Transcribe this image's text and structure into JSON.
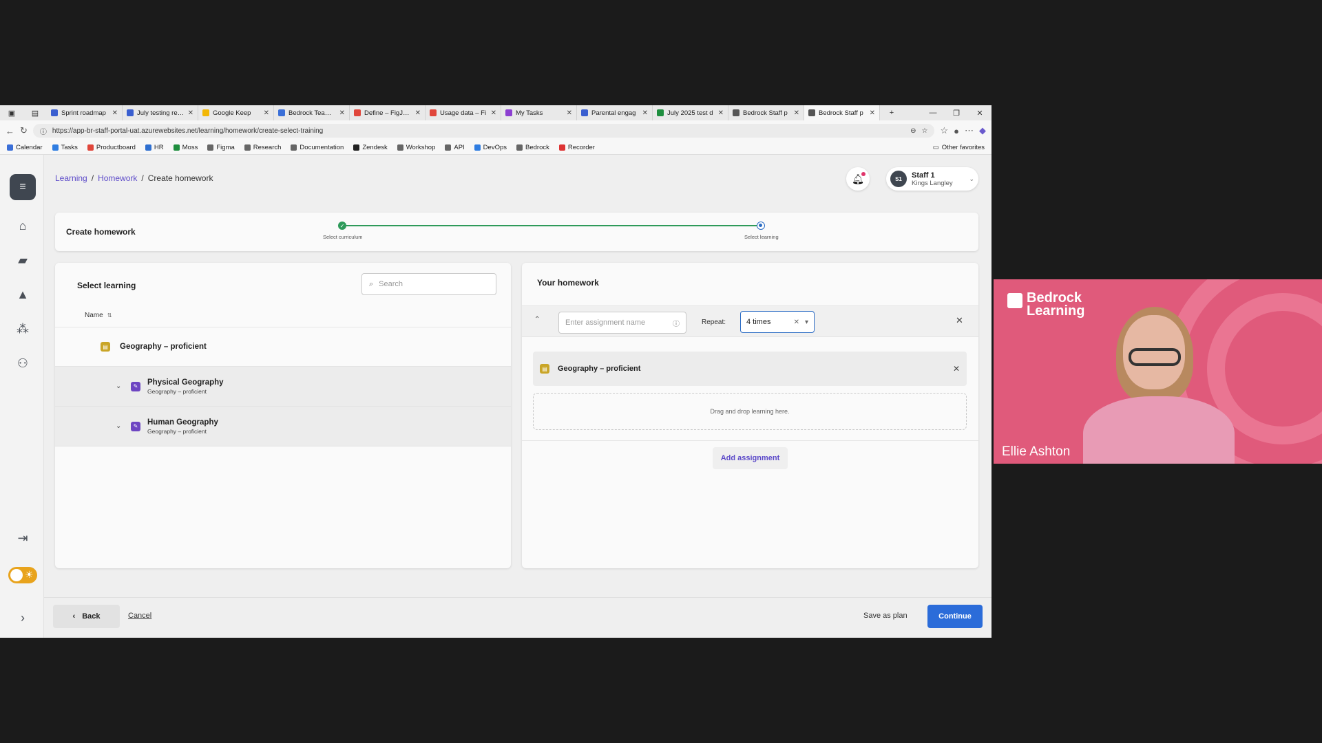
{
  "browser": {
    "tabs": [
      {
        "title": "Sprint roadmap",
        "color": "#3a5fd0"
      },
      {
        "title": "July testing requ",
        "color": "#3a5fd0"
      },
      {
        "title": "Google Keep",
        "color": "#f2b705"
      },
      {
        "title": "Bedrock Team E",
        "color": "#3a6fd8"
      },
      {
        "title": "Define – FigJam",
        "color": "#e0463b"
      },
      {
        "title": "Usage data – Fi",
        "color": "#e0463b"
      },
      {
        "title": "My Tasks",
        "color": "#8c3fd1"
      },
      {
        "title": "Parental engag",
        "color": "#3a5fd0"
      },
      {
        "title": "July 2025 test d",
        "color": "#1e8e3e"
      },
      {
        "title": "Bedrock Staff p",
        "color": "#555555"
      },
      {
        "title": "Bedrock Staff p",
        "color": "#555555"
      }
    ],
    "url": "https://app-br-staff-portal-uat.azurewebsites.net/learning/homework/create-select-training",
    "bookmarks": [
      "Calendar",
      "Tasks",
      "Productboard",
      "HR",
      "Moss",
      "Figma",
      "Research",
      "Documentation",
      "Zendesk",
      "Workshop",
      "API",
      "DevOps",
      "Bedrock",
      "Recorder"
    ],
    "other_favorites": "Other favorites"
  },
  "breadcrumb": {
    "level1": "Learning",
    "level2": "Homework",
    "current": "Create homework"
  },
  "user": {
    "initials": "S1",
    "name": "Staff 1",
    "school": "Kings Langley"
  },
  "stepper": {
    "title": "Create homework",
    "step1": "Select curriculum",
    "step2": "Select learning"
  },
  "left_panel": {
    "title": "Select learning",
    "search_placeholder": "Search",
    "column_name": "Name",
    "parent": "Geography – proficient",
    "children": [
      {
        "title": "Physical Geography",
        "sub": "Geography – proficient"
      },
      {
        "title": "Human Geography",
        "sub": "Geography – proficient"
      }
    ]
  },
  "right_panel": {
    "title": "Your homework",
    "assignment_placeholder": "Enter assignment name",
    "repeat_label": "Repeat:",
    "repeat_value": "4 times",
    "item": "Geography – proficient",
    "drop_text": "Drag and drop learning here.",
    "add_assignment": "Add assignment"
  },
  "footer": {
    "back": "Back",
    "cancel": "Cancel",
    "save_plan": "Save as plan",
    "continue": "Continue"
  },
  "video": {
    "brand_line1": "Bedrock",
    "brand_line2": "Learning",
    "participant": "Ellie Ashton"
  },
  "colors": {
    "accent": "#2b6cd9",
    "link": "#5d4bc9",
    "success": "#2e9a5a",
    "toggle": "#e8a31c"
  }
}
